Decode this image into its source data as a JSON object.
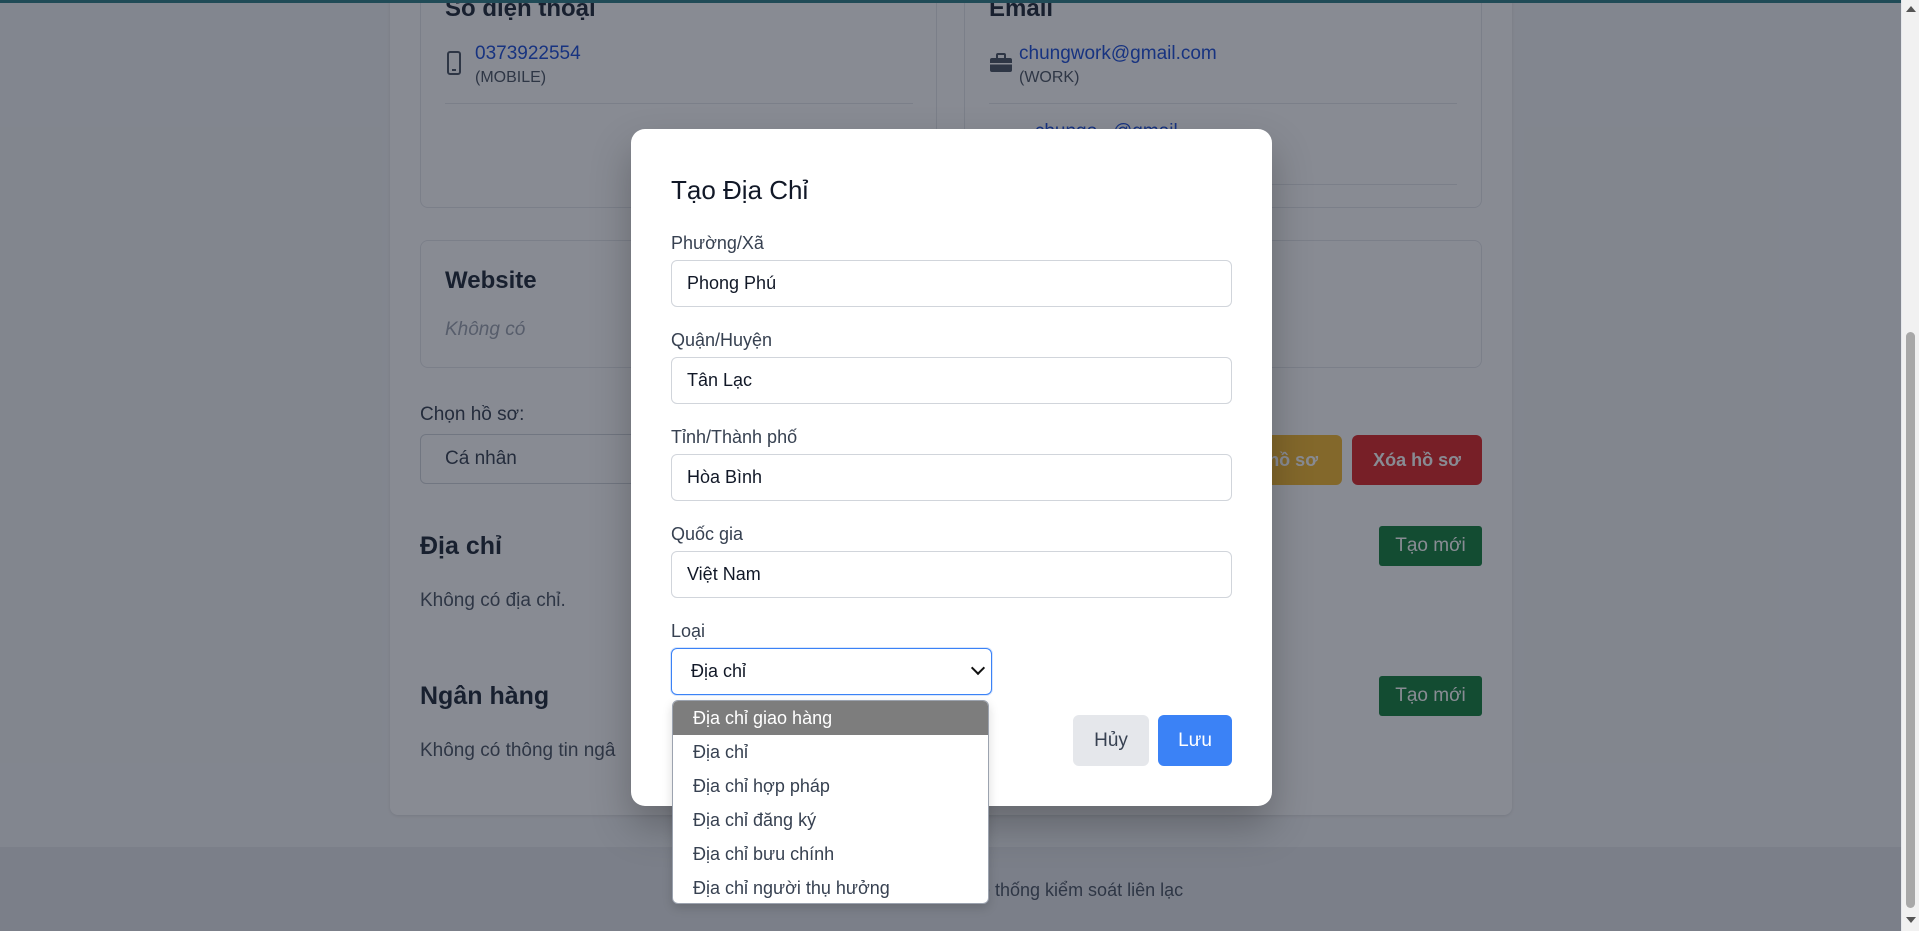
{
  "background": {
    "phone_card": {
      "title": "Số điện thoại",
      "number": "0373922554",
      "type": "(MOBILE)"
    },
    "email_card": {
      "title": "Email",
      "primary": "chungwork@gmail.com",
      "primary_type": "(WORK)",
      "secondary_partial": "...chungo...@gmail..."
    },
    "website_card": {
      "title": "Website",
      "empty_text": "Không có"
    },
    "profile": {
      "label": "Chọn hồ sơ:",
      "selected": "Cá nhân",
      "edit_button_partial": "hồ sơ",
      "delete_button": "Xóa hồ sơ"
    },
    "address_section": {
      "title": "Địa chỉ",
      "empty_text": "Không có địa chỉ.",
      "create_button": "Tạo mới"
    },
    "bank_section": {
      "title": "Ngân hàng",
      "empty_text": "Không có thông tin ngâ",
      "create_button": "Tạo mới"
    },
    "footer_text": "ệ thống kiểm soát liên lạc"
  },
  "modal": {
    "title": "Tạo Địa Chỉ",
    "fields": {
      "ward": {
        "label": "Phường/Xã",
        "value": "Phong Phú"
      },
      "district": {
        "label": "Quận/Huyện",
        "value": "Tân Lạc"
      },
      "province": {
        "label": "Tỉnh/Thành phố",
        "value": "Hòa Bình"
      },
      "country": {
        "label": "Quốc gia",
        "value": "Việt Nam"
      }
    },
    "type": {
      "label": "Loại",
      "selected": "Địa chỉ",
      "options": [
        "Địa chỉ giao hàng",
        "Địa chỉ",
        "Địa chỉ hợp pháp",
        "Địa chỉ đăng ký",
        "Địa chỉ bưu chính",
        "Địa chỉ người thụ hưởng"
      ],
      "highlighted_index": 0
    },
    "cancel_button": "Hủy",
    "save_button": "Lưu"
  },
  "colors": {
    "primary": "#3b82f6",
    "success": "#15803d",
    "danger": "#dc2626",
    "warning": "#f5b82e",
    "link": "#1d4ed8"
  }
}
